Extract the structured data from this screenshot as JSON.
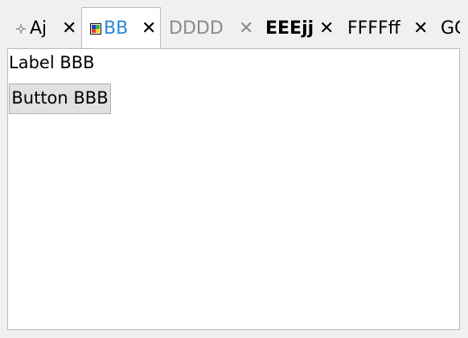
{
  "tabs": [
    {
      "label": "Aj",
      "close": "✕",
      "icon": "crosshair-icon",
      "state": "normal"
    },
    {
      "label": "BB",
      "close": "✕",
      "icon": "color-grid-icon",
      "state": "selected"
    },
    {
      "label": "DDDD",
      "close": "✕",
      "state": "disabled"
    },
    {
      "label": "EEEjj",
      "close": "✕",
      "state": "bold"
    },
    {
      "label": "FFFFff",
      "close": "✕",
      "state": "normal"
    },
    {
      "label": "GG",
      "state": "clipped"
    }
  ],
  "content": {
    "label": "Label BBB",
    "button": "Button BBB"
  },
  "colors": {
    "selected_tab_text": "#2a86d1",
    "disabled_tab_text": "#8a8a8a",
    "panel_border": "#b9b9b9",
    "button_bg": "#e1e1e1"
  }
}
